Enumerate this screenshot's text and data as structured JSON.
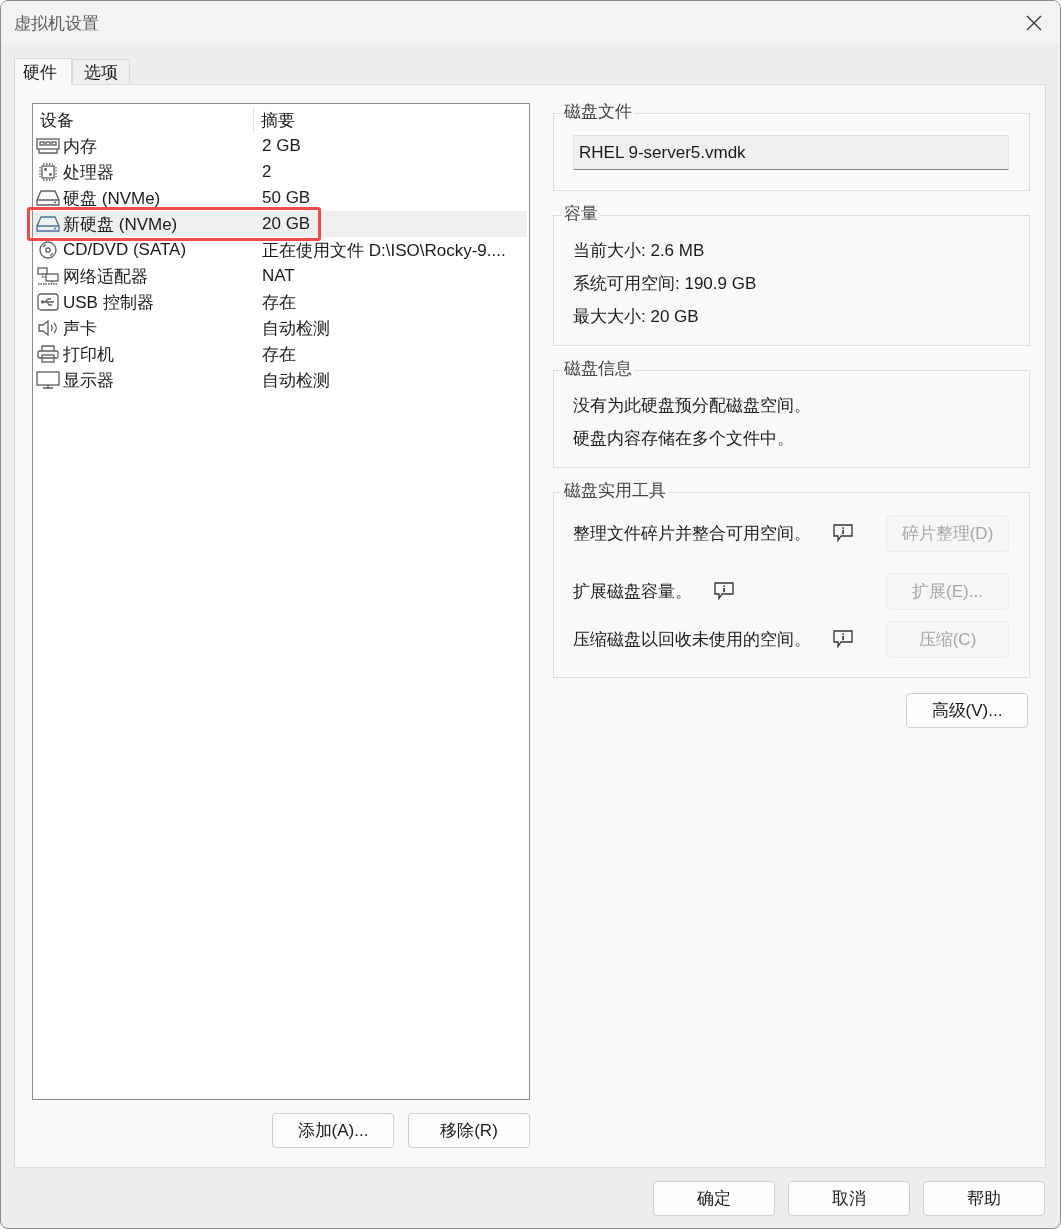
{
  "window": {
    "title": "虚拟机设置"
  },
  "tabs": [
    {
      "label": "硬件",
      "selected": true
    },
    {
      "label": "选项",
      "selected": false
    }
  ],
  "devices": {
    "columns": [
      "设备",
      "摘要"
    ],
    "rows": [
      {
        "kind": "memory",
        "name": "内存",
        "summary": "2 GB",
        "selected": false,
        "highlighted": false
      },
      {
        "kind": "processor",
        "name": "处理器",
        "summary": "2",
        "selected": false,
        "highlighted": false
      },
      {
        "kind": "disk",
        "name": "硬盘 (NVMe)",
        "summary": "50 GB",
        "selected": false,
        "highlighted": false
      },
      {
        "kind": "disk",
        "name": "新硬盘 (NVMe)",
        "summary": "20 GB",
        "selected": true,
        "highlighted": true
      },
      {
        "kind": "cdrom",
        "name": "CD/DVD (SATA)",
        "summary": "正在使用文件 D:\\ISO\\Rocky-9....",
        "selected": false,
        "highlighted": false
      },
      {
        "kind": "network",
        "name": "网络适配器",
        "summary": "NAT",
        "selected": false,
        "highlighted": false
      },
      {
        "kind": "usb",
        "name": "USB 控制器",
        "summary": "存在",
        "selected": false,
        "highlighted": false
      },
      {
        "kind": "sound",
        "name": "声卡",
        "summary": "自动检测",
        "selected": false,
        "highlighted": false
      },
      {
        "kind": "printer",
        "name": "打印机",
        "summary": "存在",
        "selected": false,
        "highlighted": false
      },
      {
        "kind": "display",
        "name": "显示器",
        "summary": "自动检测",
        "selected": false,
        "highlighted": false
      }
    ]
  },
  "device_buttons": [
    "添加(A)...",
    "移除(R)"
  ],
  "disk_file": {
    "title": "磁盘文件",
    "value": "RHEL 9-server5.vmdk"
  },
  "capacity": {
    "title": "容量",
    "lines": [
      "当前大小: 2.6 MB",
      "系统可用空间: 190.9 GB",
      "最大大小: 20 GB"
    ]
  },
  "disk_info": {
    "title": "磁盘信息",
    "lines": [
      "没有为此硬盘预分配磁盘空间。",
      "硬盘内容存储在多个文件中。"
    ]
  },
  "utilities": {
    "title": "磁盘实用工具",
    "items": [
      {
        "text": "整理文件碎片并整合可用空间。",
        "button": "碎片整理(D)",
        "disabled": true
      },
      {
        "text": "扩展磁盘容量。",
        "button": "扩展(E)...",
        "disabled": true
      },
      {
        "text": "压缩磁盘以回收未使用的空间。",
        "button": "压缩(C)",
        "disabled": true
      }
    ]
  },
  "advanced_button": "高级(V)...",
  "dialog_buttons": [
    "确定",
    "取消",
    "帮助"
  ]
}
